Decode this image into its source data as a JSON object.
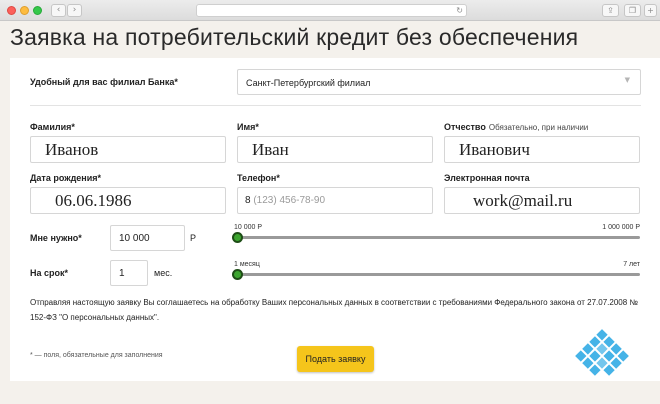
{
  "browser": {
    "back_glyph": "‹",
    "forward_glyph": "›",
    "reload_glyph": "↻",
    "share_glyph": "⇪",
    "tabs_glyph": "❐",
    "add_glyph": "+"
  },
  "page": {
    "title": "Заявка на потребительский кредит без обеспечения"
  },
  "form": {
    "branch": {
      "label": "Удобный для вас филиал Банка*",
      "value": "Санкт-Петербургский филиал",
      "caret": "▼"
    },
    "surname": {
      "label": "Фамилия*",
      "value": "Иванов"
    },
    "name": {
      "label": "Имя*",
      "value": "Иван"
    },
    "patronymic": {
      "label": "Отчество",
      "hint": "Обязательно, при наличии",
      "value": "Иванович"
    },
    "birthdate": {
      "label": "Дата рождения*",
      "value": "06.06.1986"
    },
    "phone": {
      "label": "Телефон*",
      "prefix": "8",
      "placeholder": "(123) 456-78-90"
    },
    "email": {
      "label": "Электронная почта",
      "value": "work@mail.ru"
    },
    "amount": {
      "label": "Мне нужно*",
      "value": "10 000",
      "unit": "Р",
      "slider_min": "10 000 Р",
      "slider_max": "1 000 000 Р",
      "slider_fraction": 0
    },
    "term": {
      "label": "На срок*",
      "value": "1",
      "unit": "мес.",
      "slider_min": "1 месяц",
      "slider_max": "7 лет",
      "slider_fraction": 0
    },
    "agreement": "Отправляя настоящую заявку Вы соглашаетесь на обработку Ваших персональных данных в соответствии с требованиями Федерального закона от 27.07.2008 № 152-ФЗ \"О персональных данных\".",
    "required_note": "* — поля, обязательные для заполнения",
    "submit_label": "Подать заявку"
  },
  "colors": {
    "accent_button": "#f5c51b",
    "slider_knob": "#3ca52f",
    "logo": "#45b3e7"
  }
}
